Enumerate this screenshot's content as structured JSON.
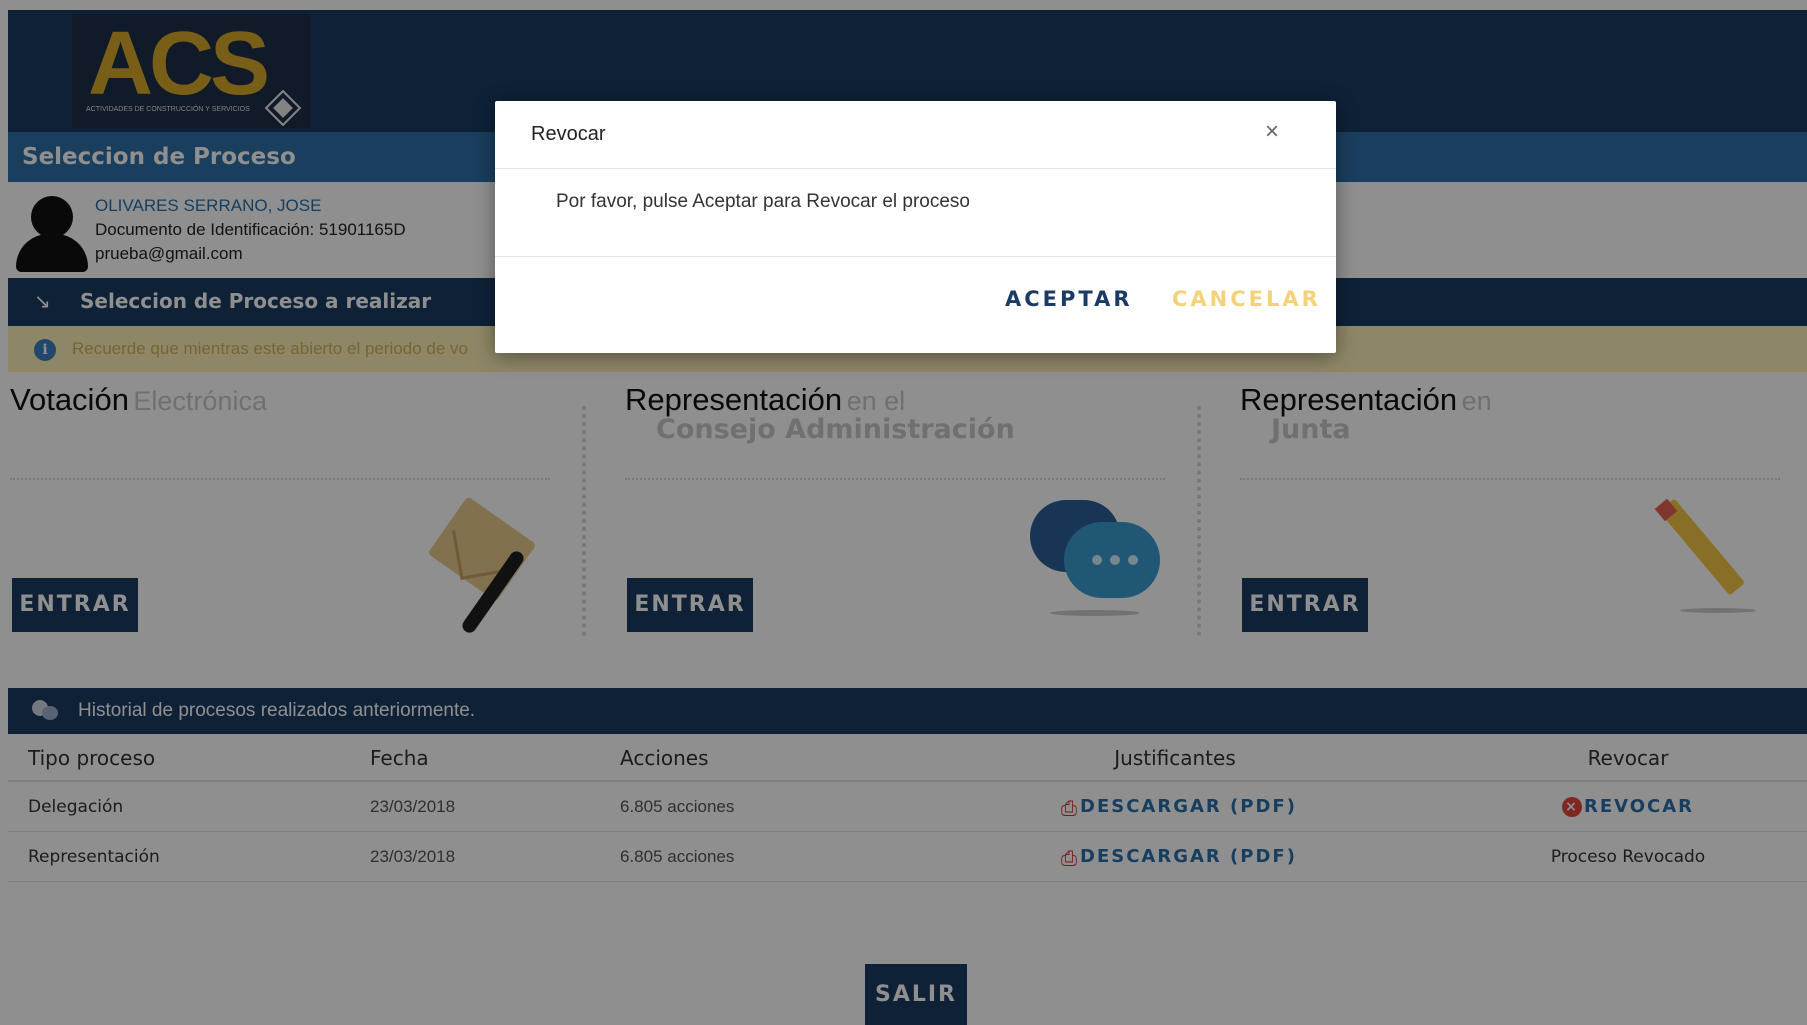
{
  "header": {
    "logo_text": "ACS",
    "logo_subtitle": "ACTIVIDADES DE CONSTRUCCIÓN Y SERVICIOS",
    "section_title": "Seleccion de Proceso"
  },
  "user": {
    "name": "OLIVARES SERRANO, JOSE",
    "document": "Documento de Identificación: 51901165D",
    "email": "prueba@gmail.com"
  },
  "selection_bar": {
    "title": "Seleccion de Proceso a realizar"
  },
  "info_bar": {
    "text": "Recuerde que mientras este abierto el periodo de vo"
  },
  "cards": [
    {
      "title_main": "Votación",
      "title_sub": "Electrónica",
      "title_sub2": "",
      "button": "ENTRAR",
      "icon": "envelope-icon"
    },
    {
      "title_main": "Representación",
      "title_sub": "en el",
      "title_sub2": "Consejo Administración",
      "button": "ENTRAR",
      "icon": "chat-bubbles-icon"
    },
    {
      "title_main": "Representación",
      "title_sub": "en",
      "title_sub2": "Junta",
      "button": "ENTRAR",
      "icon": "pencil-icon"
    }
  ],
  "history": {
    "title": "Historial de procesos realizados anteriormente.",
    "columns": [
      "Tipo proceso",
      "Fecha",
      "Acciones",
      "Justificantes",
      "Revocar"
    ],
    "rows": [
      {
        "tipo": "Delegación",
        "fecha": "23/03/2018",
        "acciones": "6.805 acciones",
        "justificante": "DESCARGAR (PDF)",
        "revocar": "REVOCAR"
      },
      {
        "tipo": "Representación",
        "fecha": "23/03/2018",
        "acciones": "6.805 acciones",
        "justificante": "DESCARGAR (PDF)",
        "revocar": "Proceso Revocado"
      }
    ]
  },
  "salir_button": "SALIR",
  "modal": {
    "title": "Revocar",
    "close_glyph": "×",
    "message": "Por favor, pulse Aceptar para Revocar el proceso",
    "accept_label": "ACEPTAR",
    "cancel_label": "CANCELAR"
  },
  "colors": {
    "primary_dark": "#1a3b63",
    "primary_light": "#2f6fa8",
    "accent_gold": "#d7a82a",
    "cancel_yellow": "#f3d27a",
    "info_bg": "#fdf0b8"
  }
}
